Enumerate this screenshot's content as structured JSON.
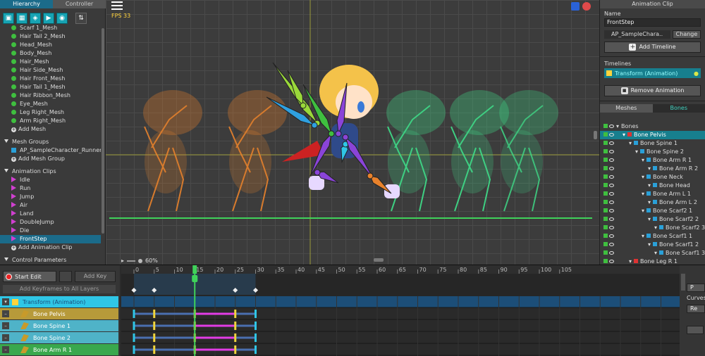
{
  "hierarchy": {
    "tabs": [
      "Hierarchy",
      "Controller"
    ],
    "mesh_items": [
      "Scarf 1_Mesh",
      "Hair Tail 2_Mesh",
      "Head_Mesh",
      "Body_Mesh",
      "Hair_Mesh",
      "Hair Side_Mesh",
      "Hair Front_Mesh",
      "Hair Tail 1_Mesh",
      "Hair Ribbon_Mesh",
      "Eye_Mesh",
      "Leg Right_Mesh",
      "Arm Right_Mesh"
    ],
    "add_mesh": "Add Mesh",
    "mesh_groups_header": "Mesh Groups",
    "mesh_group_item": "AP_SampleCharacter_Runner",
    "add_mesh_group": "Add Mesh Group",
    "anim_clips_header": "Animation Clips",
    "anim_clips": [
      "Idle",
      "Run",
      "Jump",
      "Air",
      "Land",
      "DoubleJump",
      "Die",
      "FrontStep"
    ],
    "selected_clip": "FrontStep",
    "add_anim_clip": "Add Animation Clip",
    "control_params": "Control Parameters"
  },
  "viewport": {
    "fps": "FPS 33",
    "zoom": "60%"
  },
  "animation_clip": {
    "header": "Animation Clip",
    "name_label": "Name",
    "name_value": "FrontStep",
    "target": "AP_SampleChara..",
    "change_button": "Change",
    "add_timeline_button": "Add Timeline",
    "timelines_label": "Timelines",
    "timeline_item": "Transform (Animation)",
    "remove_animation_button": "Remove Animation",
    "tabs": [
      "Meshes",
      "Bones"
    ]
  },
  "bones": [
    {
      "name": "Bones",
      "depth": 0,
      "root": true
    },
    {
      "name": "Bone Pelvis",
      "depth": 1,
      "selected": true
    },
    {
      "name": "Bone Spine 1",
      "depth": 2
    },
    {
      "name": "Bone Spine 2",
      "depth": 3
    },
    {
      "name": "Bone Arm R 1",
      "depth": 4
    },
    {
      "name": "Bone Arm R 2",
      "depth": 5
    },
    {
      "name": "Bone Neck",
      "depth": 4
    },
    {
      "name": "Bone Head",
      "depth": 5
    },
    {
      "name": "Bone Arm L 1",
      "depth": 4
    },
    {
      "name": "Bone Arm L 2",
      "depth": 5
    },
    {
      "name": "Bone Scarf2 1",
      "depth": 4
    },
    {
      "name": "Bone Scarf2 2",
      "depth": 5
    },
    {
      "name": "Bone Scarf2 3",
      "depth": 6
    },
    {
      "name": "Bone Scarf1 1",
      "depth": 4
    },
    {
      "name": "Bone Scarf1 2",
      "depth": 5
    },
    {
      "name": "Bone Scarf1 3",
      "depth": 6
    },
    {
      "name": "Bone Leg R 1",
      "depth": 2
    }
  ],
  "timeline": {
    "start_edit": "Start Edit",
    "add_key": "Add Key",
    "add_keyframes_all": "Add Keyframes to All Layers",
    "ruler": [
      "0",
      "5",
      "10",
      "15",
      "20",
      "25",
      "30",
      "35",
      "40",
      "45",
      "50",
      "55",
      "60",
      "65",
      "70",
      "75",
      "80",
      "85",
      "90",
      "95",
      "100",
      "105"
    ],
    "current_frame": 15,
    "range": [
      0,
      30
    ],
    "tracks": [
      {
        "name": "Transform (Animation)",
        "type": "timeline",
        "color": "#2fc6e6"
      },
      {
        "name": "Bone Pelvis",
        "type": "bone",
        "color": "#b79a3a"
      },
      {
        "name": "Bone Spine 1",
        "type": "bone",
        "color": "#4fb3c8"
      },
      {
        "name": "Bone Spine 2",
        "type": "bone",
        "color": "#4fb3c8"
      },
      {
        "name": "Bone Arm R 1",
        "type": "bone",
        "color": "#39a84d"
      }
    ],
    "right_buttons": [
      "P",
      "Re"
    ],
    "curves_label": "Curves"
  },
  "colors": {
    "accent": "#1b6b8a",
    "selection": "#177f8e",
    "onion_orange": "#e8822c",
    "onion_green": "#3fe08a",
    "ground_line": "#3fd25a",
    "key_yellow": "#f0d43c",
    "key_magenta": "#e23ce6"
  },
  "icons": [
    "playlist-icon",
    "mesh-icon",
    "mesh-group-icon",
    "anim-icon",
    "param-icon",
    "sort-icon",
    "menu-icon",
    "bone-icon",
    "eye-icon",
    "record-icon"
  ]
}
